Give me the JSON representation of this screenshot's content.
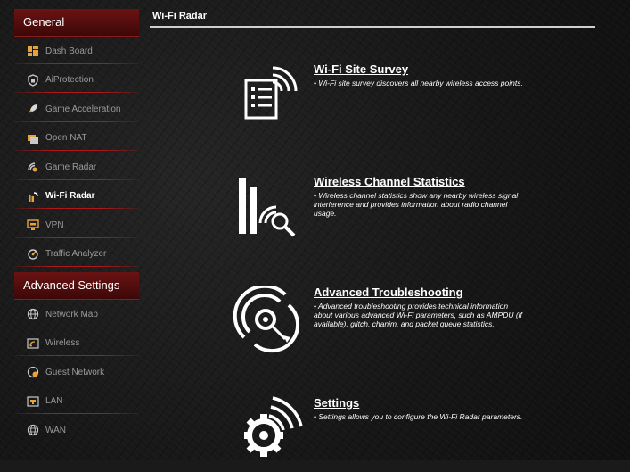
{
  "page": {
    "title": "Wi-Fi Radar"
  },
  "sidebar": {
    "general_header": "General",
    "general_items": [
      {
        "label": "Dash Board",
        "icon": "dashboard-icon"
      },
      {
        "label": "AiProtection",
        "icon": "shield-icon"
      },
      {
        "label": "Game Acceleration",
        "icon": "rocket-icon"
      },
      {
        "label": "Open NAT",
        "icon": "nat-icon"
      },
      {
        "label": "Game Radar",
        "icon": "radar-icon"
      },
      {
        "label": "Wi-Fi Radar",
        "icon": "wifi-radar-icon",
        "active": true
      },
      {
        "label": "VPN",
        "icon": "vpn-icon"
      },
      {
        "label": "Traffic Analyzer",
        "icon": "traffic-icon"
      }
    ],
    "advanced_header": "Advanced Settings",
    "advanced_items": [
      {
        "label": "Network Map",
        "icon": "globe-icon"
      },
      {
        "label": "Wireless",
        "icon": "wireless-icon"
      },
      {
        "label": "Guest Network",
        "icon": "guest-network-icon"
      },
      {
        "label": "LAN",
        "icon": "lan-icon"
      },
      {
        "label": "WAN",
        "icon": "wan-icon"
      }
    ]
  },
  "features": [
    {
      "title": "Wi-Fi Site Survey",
      "description": "•  Wi-Fi site survey discovers all nearby wireless access points.",
      "icon": "site-survey-icon"
    },
    {
      "title": "Wireless Channel Statistics",
      "description": "•  Wireless channel statistics show any nearby wireless signal interference and provides information about radio channel usage.",
      "icon": "channel-statistics-icon"
    },
    {
      "title": "Advanced Troubleshooting",
      "description": "•  Advanced troubleshooting provides technical information about various advanced Wi-Fi parameters, such as AMPDU (if available), glitch, chanim, and packet queue statistics.",
      "icon": "troubleshooting-icon"
    },
    {
      "title": "Settings",
      "description": "•  Settings allows you to configure the Wi-Fi Radar parameters.",
      "icon": "settings-gear-icon"
    }
  ],
  "colors": {
    "accent_red": "#b01818",
    "header_red": "#6b1313",
    "menu_text": "#9a9a9a"
  }
}
